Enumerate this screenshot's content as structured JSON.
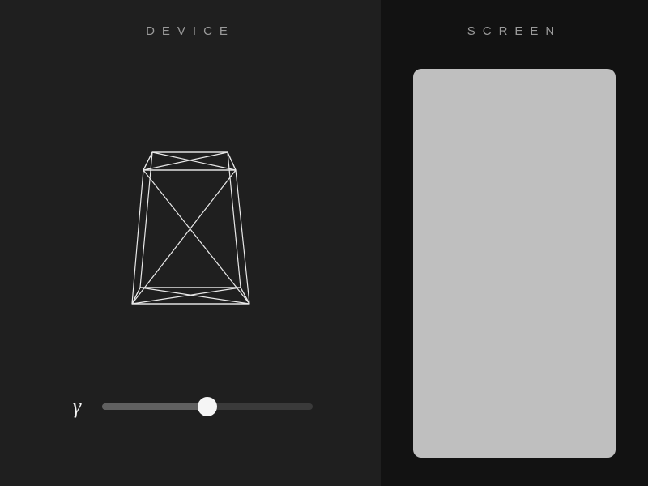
{
  "left": {
    "title": "DEVICE",
    "gamma_glyph": "γ",
    "slider": {
      "min": -180,
      "max": 180,
      "value": 0,
      "fill_percent": 50
    },
    "wireframe_icon": "device-wireframe-icon"
  },
  "right": {
    "title": "SCREEN",
    "preview_bg": "#bfbfbf"
  },
  "colors": {
    "panel_left_bg": "#1f1f1f",
    "panel_right_bg": "#121212",
    "header_text": "#9a9a9a",
    "wire_stroke": "#e9e9e9",
    "track_bg": "#3a3a3a",
    "track_fill": "#606060",
    "knob": "#f5f5f5"
  }
}
